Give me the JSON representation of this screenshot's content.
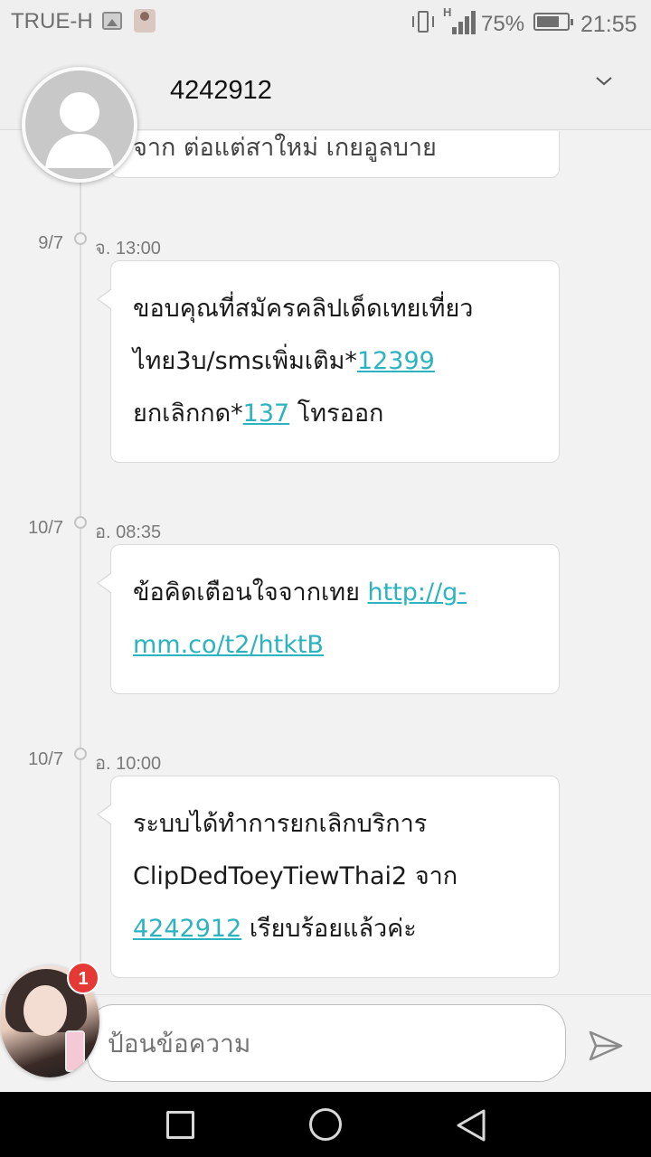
{
  "status_bar": {
    "carrier": "TRUE-H",
    "network": "H",
    "battery_percent": "75%",
    "battery_level": 0.75,
    "time": "21:55",
    "icons": [
      "gallery-icon",
      "notification-avatar-icon",
      "vibrate-icon",
      "signal-icon",
      "battery-icon"
    ]
  },
  "header": {
    "title": "4242912",
    "icons": [
      "contact-avatar-icon",
      "chevron-down-icon"
    ]
  },
  "messages": [
    {
      "partial_text": "จาก ต่อแต่สาใหม่ เกยอูลบาย"
    },
    {
      "date": "9/7",
      "time": "จ. 13:00",
      "line1": "ขอบคุณที่สมัครคลิปเด็ดเทยเที่ยว",
      "line2_pre": "ไทย3บ/smsเพิ่มเติม*",
      "line2_link": "12399",
      "line3_pre": "ยกเลิกกด*",
      "line3_link": "137",
      "line3_post": " โทรออก"
    },
    {
      "date": "10/7",
      "time": "อ. 08:35",
      "line1_pre": "ข้อคิดเตือนใจจากเทย ",
      "line1_link": "http://g-",
      "line2_link": "mm.co/t2/htktB"
    },
    {
      "date": "10/7",
      "time": "อ. 10:00",
      "line1": "ระบบได้ทำการยกเลิกบริการ",
      "line2": "ClipDedToeyTiewThai2 จาก",
      "line3_link": "4242912",
      "line3_post": " เรียบร้อยแล้วค่ะ"
    }
  ],
  "compose": {
    "placeholder": "ป้อนข้อความ",
    "badge_count": "1",
    "icons": [
      "chat-head-avatar",
      "send-icon"
    ]
  },
  "nav_bar": {
    "icons": [
      "recent-apps-icon",
      "home-icon",
      "back-icon"
    ]
  },
  "colors": {
    "link": "#2bb3c0",
    "badge": "#e53935",
    "background": "#f2f2f2"
  }
}
